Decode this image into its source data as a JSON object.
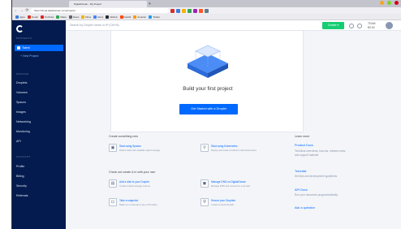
{
  "browser": {
    "tab_title": "DigitalOcean - My Project",
    "new_tab": "+",
    "url": "https://cloud.digitalocean.com/projects",
    "nav": [
      "←",
      "→",
      "⟳"
    ],
    "bookmarks": [
      {
        "label": "Apps",
        "color": "#3b7ddd"
      },
      {
        "label": "Gmail",
        "color": "#d93025"
      },
      {
        "label": "YouTube",
        "color": "#e62117"
      },
      {
        "label": "Maps",
        "color": "#34a853"
      },
      {
        "label": "News",
        "color": "#5f6368"
      },
      {
        "label": "Drive",
        "color": "#f4b400"
      },
      {
        "label": "Docs",
        "color": "#4285f4"
      },
      {
        "label": "GitHub",
        "color": "#24292e"
      },
      {
        "label": "Reddit",
        "color": "#ff4500"
      },
      {
        "label": "Amazon",
        "color": "#ff9900"
      },
      {
        "label": "Twitter",
        "color": "#1da1f2"
      }
    ],
    "window_controls": [
      "#f5a623",
      "#7ed321",
      "#d0021b"
    ]
  },
  "sidebar": {
    "projects_heading": "PROJECTS",
    "selected_project": "Talent",
    "new_project": "+ New Project",
    "manage_heading": "MANAGE",
    "manage_items": [
      "Droplets",
      "Volumes",
      "Spaces",
      "Images",
      "Networking",
      "Monitoring",
      "API"
    ],
    "account_heading": "ACCOUNT",
    "account_items": [
      "Profile",
      "Billing",
      "Security",
      "Referrals"
    ]
  },
  "topbar": {
    "search_placeholder": "Search by Droplet name or IP (Ctrl+B)",
    "create_label": "Create ▾",
    "account_line1": "TEAM",
    "account_line2": "$0.00"
  },
  "card": {
    "title": "Build your first project",
    "button": "Get Started with a Droplet"
  },
  "create": {
    "heading": "Create something new",
    "tiles": [
      {
        "icon": "▣",
        "title": "Start using Spaces",
        "desc": "Deliver data with scalable object storage"
      },
      {
        "icon": "⚲",
        "title": "Start using Kubernetes",
        "desc": "Deploy and scale containers with Kubernetes"
      }
    ]
  },
  "explore": {
    "heading": "Check out create & in with your own",
    "tiles": [
      {
        "icon": "▤",
        "title": "Add a disk to your Droplet",
        "desc": "Create a block storage volume"
      },
      {
        "icon": "◼",
        "title": "Manage DNS on DigitalOcean",
        "desc": "Manage DNS and connect to a domain"
      },
      {
        "icon": "⊡",
        "title": "Take a snapshot",
        "desc": "Make an on-demand copy of Droplets"
      },
      {
        "icon": "⛨",
        "title": "Secure your Droplets",
        "desc": "Create a cloud firewall"
      }
    ]
  },
  "learn": {
    "heading": "Learn more",
    "links": [
      {
        "title": "Product Docs",
        "desc": "Technical overviews, how-tos, release notes, and support material"
      },
      {
        "title": "Tutorials",
        "desc": "DevOps and development guidelines"
      },
      {
        "title": "API Docs",
        "desc": "Run your resources programmatically"
      },
      {
        "title": "Ask a question",
        "desc": ""
      }
    ]
  },
  "colors": {
    "sidebar_bg": "#031b4e",
    "accent": "#0069ff",
    "create_button": "#15cd72"
  }
}
